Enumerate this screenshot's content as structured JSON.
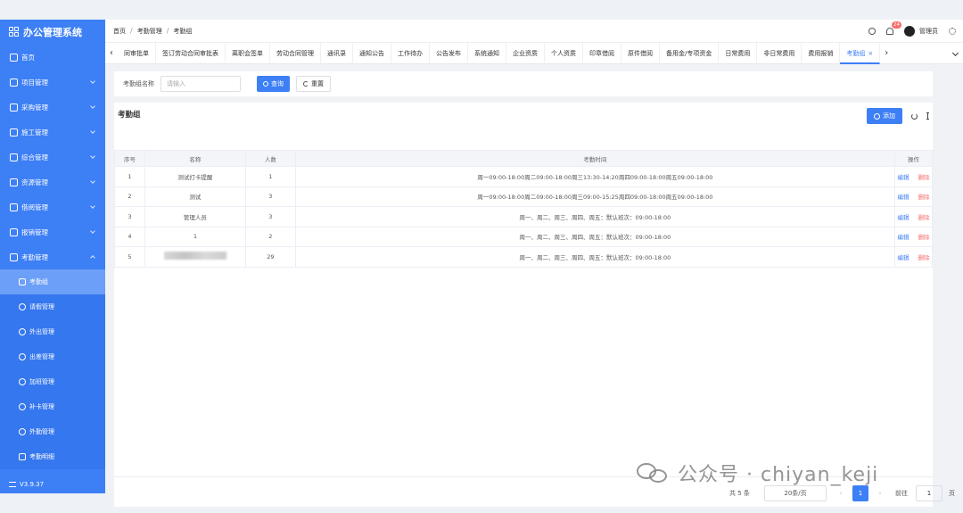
{
  "app": {
    "title": "办公管理系统",
    "version": "V3.9.37"
  },
  "sidebar": {
    "items": [
      {
        "label": "首页",
        "icon": "home-icon"
      },
      {
        "label": "项目管理",
        "icon": "project-icon"
      },
      {
        "label": "采购管理",
        "icon": "purchase-icon"
      },
      {
        "label": "施工管理",
        "icon": "construction-icon"
      },
      {
        "label": "综合管理",
        "icon": "general-icon"
      },
      {
        "label": "资源管理",
        "icon": "resource-icon"
      },
      {
        "label": "借阅管理",
        "icon": "borrow-icon"
      },
      {
        "label": "报销管理",
        "icon": "reimburse-icon"
      },
      {
        "label": "考勤管理",
        "icon": "attendance-icon"
      }
    ],
    "sub_items": [
      {
        "label": "考勤组",
        "icon": "group-icon"
      },
      {
        "label": "请假管理",
        "icon": "leave-icon"
      },
      {
        "label": "外出管理",
        "icon": "outing-icon"
      },
      {
        "label": "出差管理",
        "icon": "trip-icon"
      },
      {
        "label": "加班管理",
        "icon": "overtime-icon"
      },
      {
        "label": "补卡管理",
        "icon": "card-icon"
      },
      {
        "label": "外勤管理",
        "icon": "field-icon"
      },
      {
        "label": "考勤明细",
        "icon": "detail-icon"
      }
    ]
  },
  "header": {
    "breadcrumb": [
      "首页",
      "考勤管理",
      "考勤组"
    ],
    "notification_count": "24",
    "user_name": "管理员"
  },
  "tabs": [
    "同审批单",
    "签订劳动合同审批表",
    "离职会签单",
    "劳动合同管理",
    "通讯录",
    "通知公告",
    "工作待办",
    "公告发布",
    "系统通知",
    "企业资质",
    "个人资质",
    "印章借阅",
    "原件借阅",
    "备用金/专项资金",
    "日常费用",
    "非日常费用",
    "费用报销",
    "考勤组"
  ],
  "search": {
    "label": "考勤组名称",
    "placeholder": "请输入",
    "search_button": "查询",
    "reset_button": "重置"
  },
  "table": {
    "title": "考勤组",
    "add_button": "添加",
    "columns": [
      "序号",
      "名称",
      "人数",
      "考勤时间",
      "操作"
    ],
    "rows": [
      {
        "index": "1",
        "name": "测试打卡提醒",
        "count": "1",
        "time": "周一09:00-18:00周二09:00-18:00周三13:30-14:20周四09:00-18:00周五09:00-18:00"
      },
      {
        "index": "2",
        "name": "测试",
        "count": "3",
        "time": "周一09:00-18:00周二09:00-18:00周三09:00-15:25周四09:00-18:00周五09:00-18:00"
      },
      {
        "index": "3",
        "name": "管理人员",
        "count": "3",
        "time": "周一、周二、周三、周四、周五：默认班次：09:00-18:00"
      },
      {
        "index": "4",
        "name": "1",
        "count": "2",
        "time": "周一、周二、周三、周四、周五：默认班次：09:00-18:00"
      },
      {
        "index": "5",
        "name": "",
        "count": "29",
        "time": "周一、周二、周三、周四、周五：默认班次：09:00-18:00"
      }
    ],
    "edit_label": "编辑",
    "delete_label": "删除"
  },
  "pagination": {
    "total": "共 5 条",
    "page_size": "20条/页",
    "current_page": "1",
    "goto_label": "前往",
    "goto_value": "1",
    "page_unit": "页"
  },
  "watermark": {
    "text": "公众号 · chiyan_keji"
  },
  "colors": {
    "primary": "#3d7ff5",
    "danger": "#f56c6c",
    "sidebar": "#3d7ff5"
  }
}
